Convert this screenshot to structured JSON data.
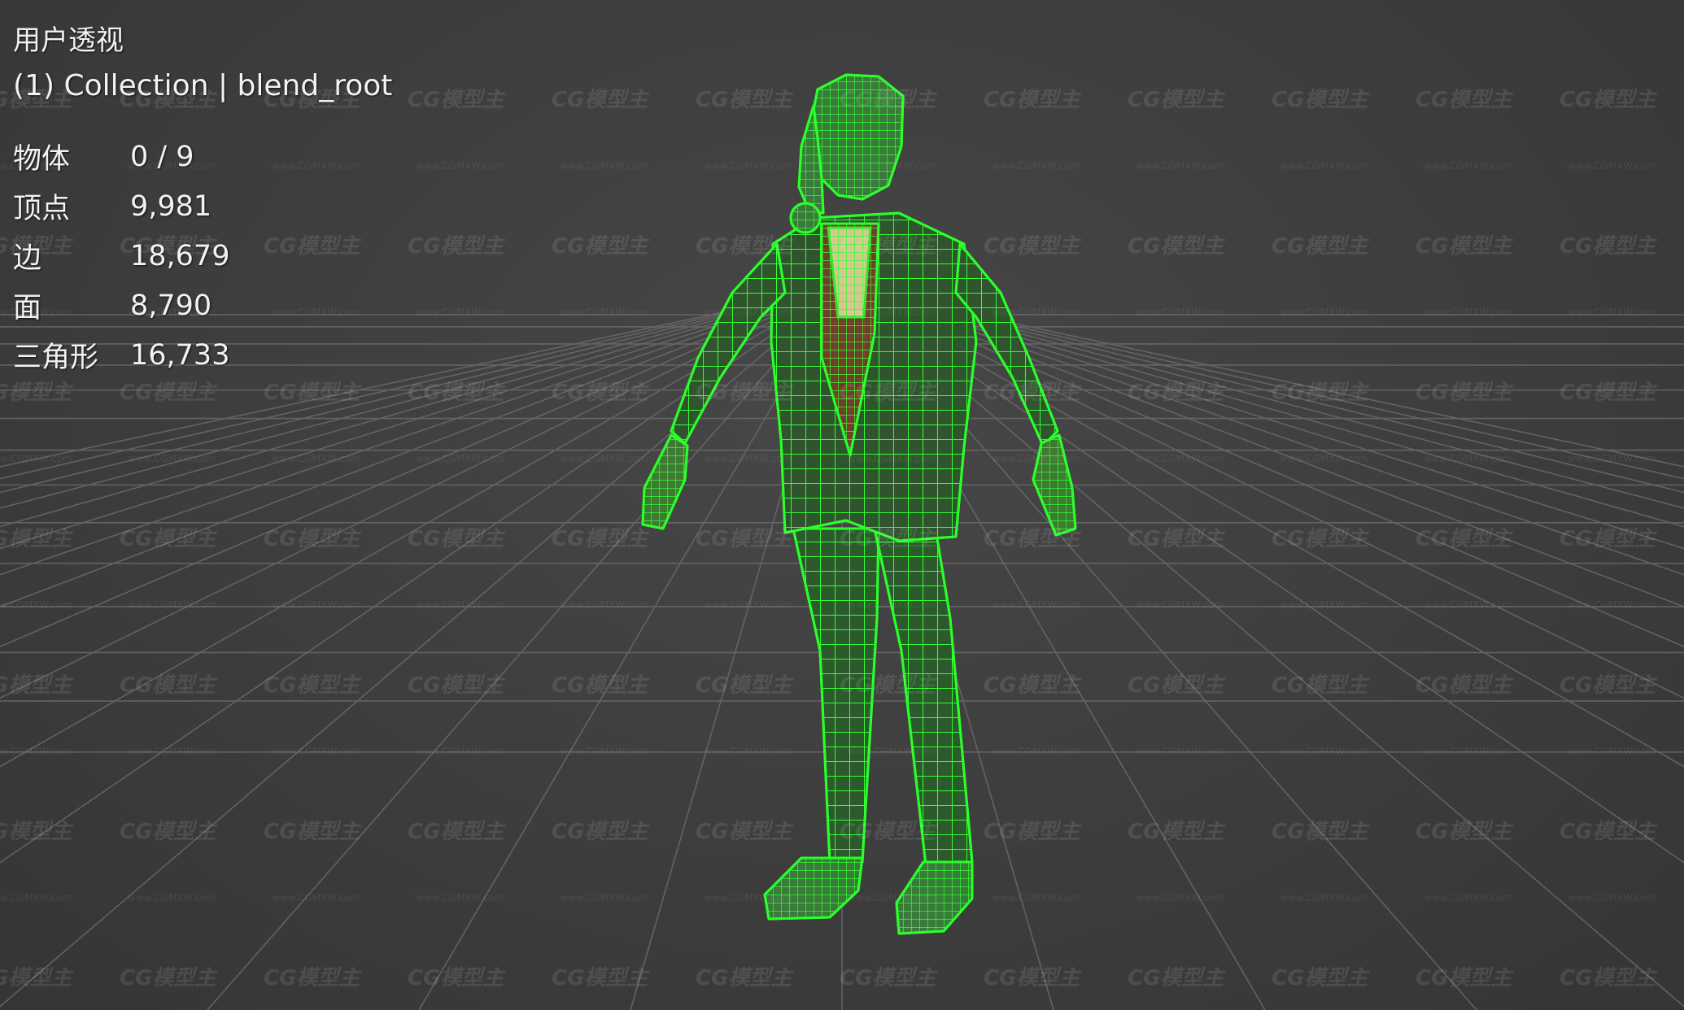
{
  "viewport": {
    "view_name": "用户透视",
    "collection_line": "(1) Collection | blend_root"
  },
  "stats": [
    {
      "label": "物体",
      "value": "0 / 9"
    },
    {
      "label": "顶点",
      "value": "9,981"
    },
    {
      "label": "边",
      "value": "18,679"
    },
    {
      "label": "面",
      "value": "8,790"
    },
    {
      "label": "三角形",
      "value": "16,733"
    }
  ],
  "watermark": {
    "logo_text": "CG模型主",
    "url_text": "www.CGMXW.com"
  },
  "colors": {
    "background": "#3c3c3c",
    "grid": "#6e6e6e",
    "wireframe": "#27e827",
    "text": "#f2f2f2"
  }
}
